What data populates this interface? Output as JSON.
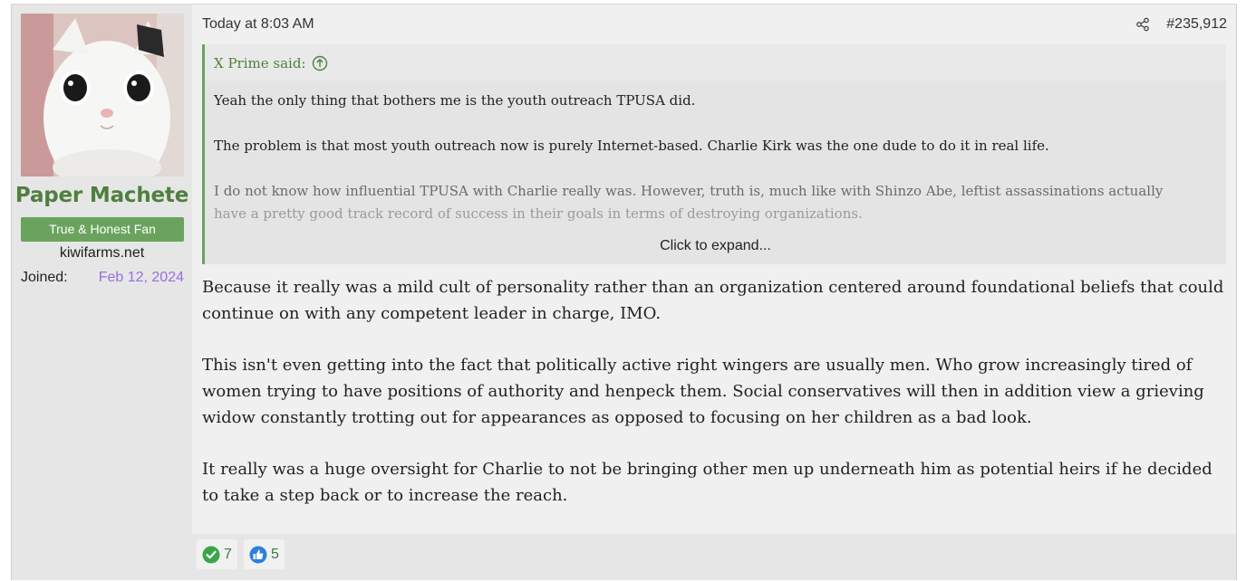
{
  "user": {
    "name": "Paper Machete",
    "title": "True & Honest Fan",
    "site": "kiwifarms.net",
    "joined_label": "Joined:",
    "joined_date": "Feb 12, 2024"
  },
  "post": {
    "date": "Today at 8:03 AM",
    "number": "#235,912",
    "share_icon": "share-icon"
  },
  "quote": {
    "author": "X Prime said:",
    "paragraphs": [
      "Yeah the only thing that bothers me is the youth outreach TPUSA did.",
      "The problem is that most youth outreach now is purely Internet-based. Charlie Kirk was the one dude to do it in real life.",
      "I do not know how influential TPUSA with Charlie really was. However, truth is, much like with Shinzo Abe, leftist assassinations actually",
      "have a pretty good track record of success in their goals in terms of destroying organizations."
    ],
    "expand_label": "Click to expand..."
  },
  "message": {
    "paragraphs": [
      "Because it really was a mild cult of personality rather than an organization centered around foundational beliefs that could continue on with any competent leader in charge, IMO.",
      "This isn't even getting into the fact that politically active right wingers are usually men. Who grow increasingly tired of women trying to have positions of authority and henpeck them. Social conservatives will then in addition view a grieving widow constantly trotting out for appearances as opposed to focusing on her children as a bad look.",
      "It really was a huge oversight for Charlie to not be bringing other men up underneath him as potential heirs if he decided to take a step back or to increase the reach."
    ]
  },
  "reactions": [
    {
      "icon": "check-reaction-icon",
      "count": "7",
      "color": "#3aa64a"
    },
    {
      "icon": "thumbs-up-reaction-icon",
      "count": "5",
      "color": "#2b7fe0"
    }
  ],
  "colors": {
    "accent_green": "#4f7f3f",
    "title_badge": "#6aa35e",
    "joined_date": "#9b6ee0"
  }
}
